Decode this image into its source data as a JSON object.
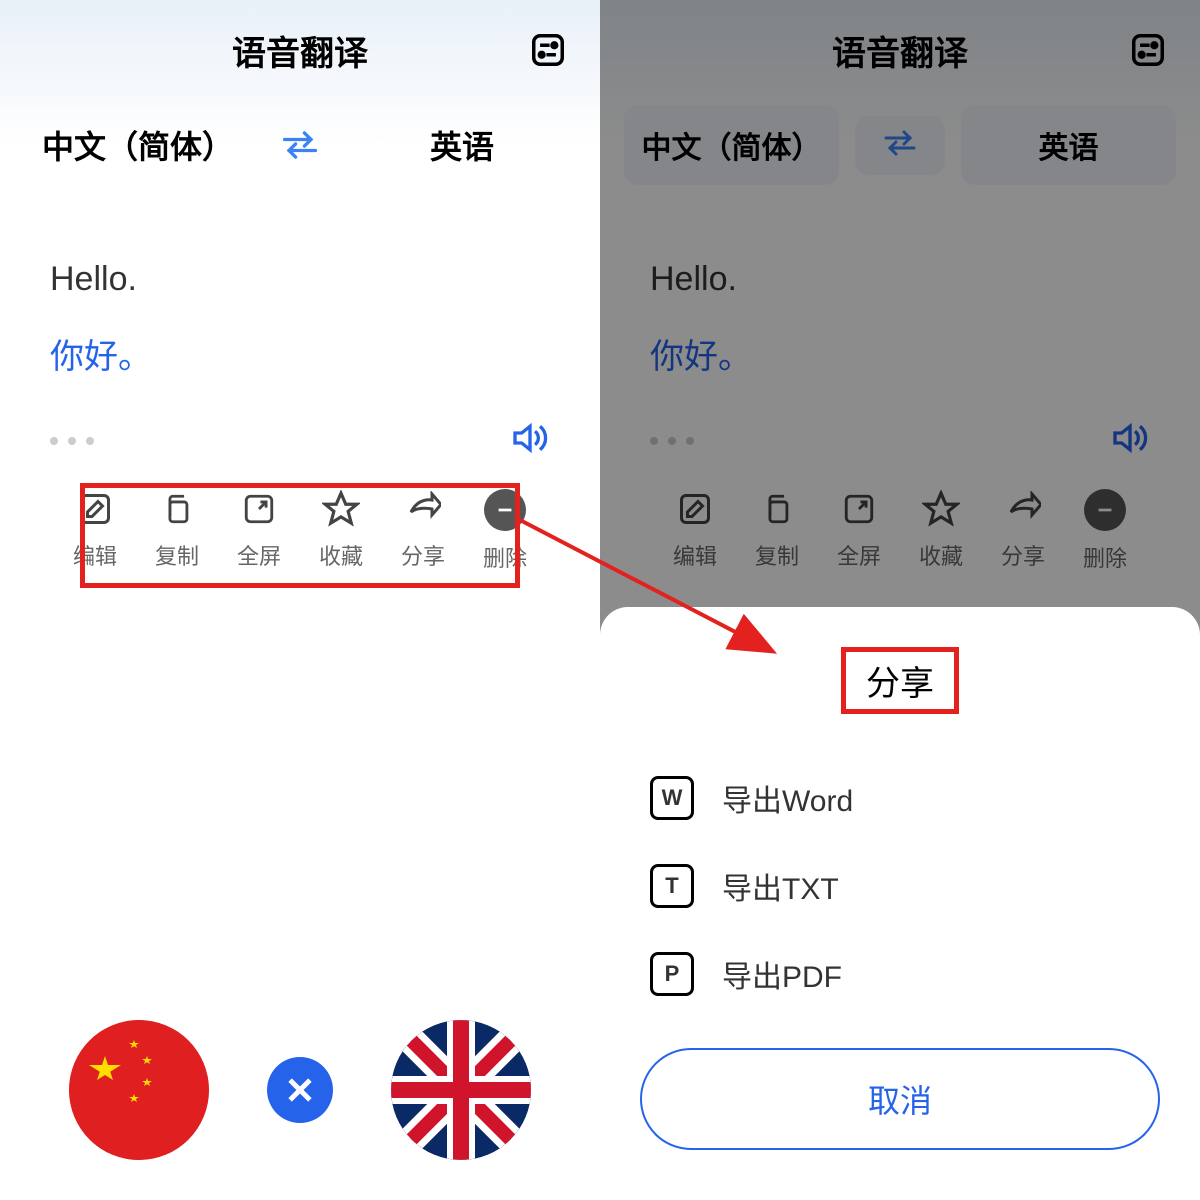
{
  "header": {
    "title": "语音翻译"
  },
  "languages": {
    "source": "中文（简体）",
    "target": "英语"
  },
  "card": {
    "source_text": "Hello.",
    "target_text": "你好。"
  },
  "toolbar": {
    "edit": "编辑",
    "copy": "复制",
    "fullscreen": "全屏",
    "favorite": "收藏",
    "share": "分享",
    "delete": "删除"
  },
  "sheet": {
    "title": "分享",
    "export_word": "导出Word",
    "export_txt": "导出TXT",
    "export_pdf": "导出PDF",
    "cancel": "取消"
  }
}
